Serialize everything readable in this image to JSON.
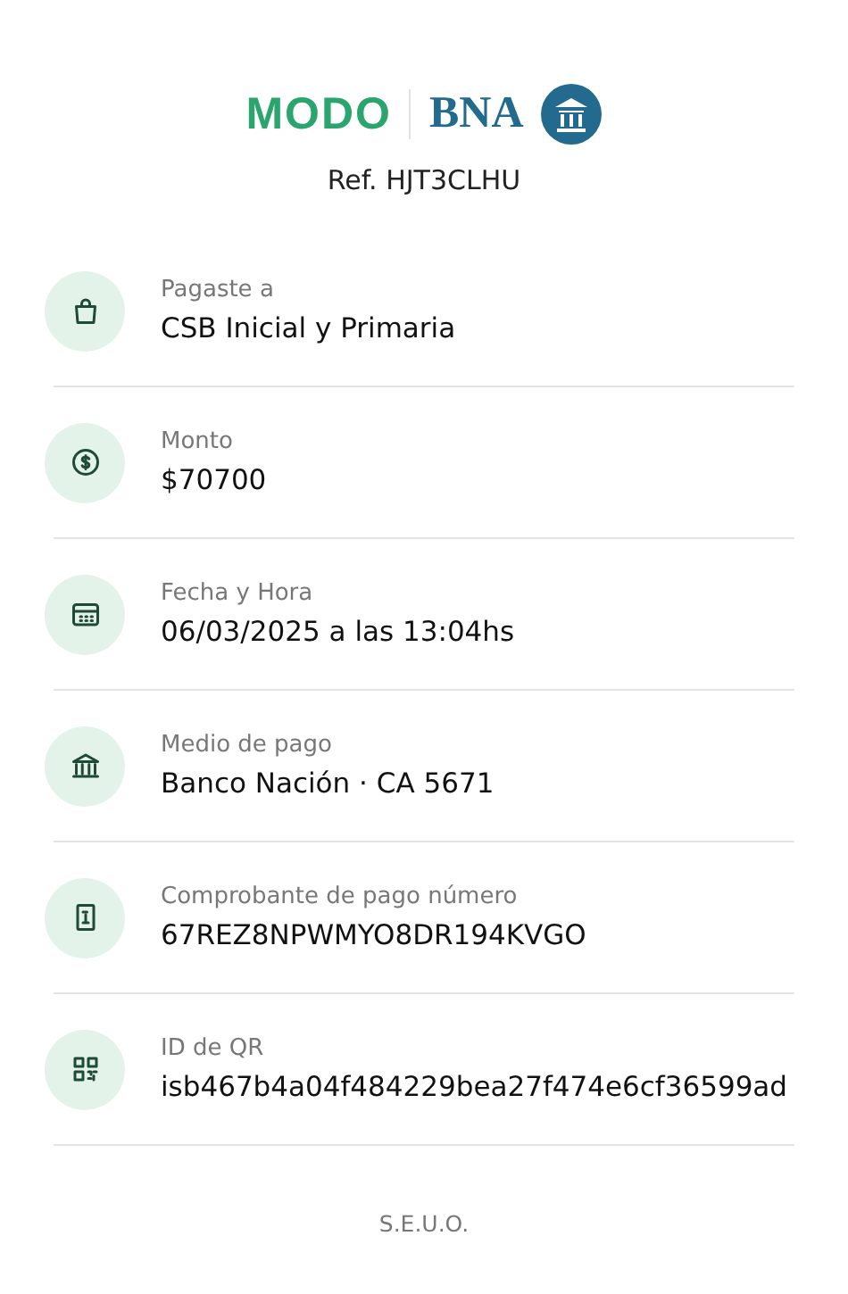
{
  "header": {
    "logo_left": "MODO",
    "logo_right": "BNA",
    "reference": "Ref. HJT3CLHU"
  },
  "items": [
    {
      "kind": "bag",
      "label": "Pagaste a",
      "value": "CSB Inicial y Primaria"
    },
    {
      "kind": "money",
      "label": "Monto",
      "value": "$70700"
    },
    {
      "kind": "calendar",
      "label": "Fecha y Hora",
      "value": "06/03/2025 a las 13:04hs"
    },
    {
      "kind": "bank",
      "label": "Medio de pago",
      "value": "Banco Nación · CA 5671"
    },
    {
      "kind": "receipt",
      "label": "Comprobante de pago número",
      "value": "67REZ8NPWMYO8DR194KVGO"
    },
    {
      "kind": "qr",
      "label": "ID de QR",
      "value": "isb467b4a04f484229bea27f474e6cf36599ad"
    }
  ],
  "footer": "S.E.U.O."
}
